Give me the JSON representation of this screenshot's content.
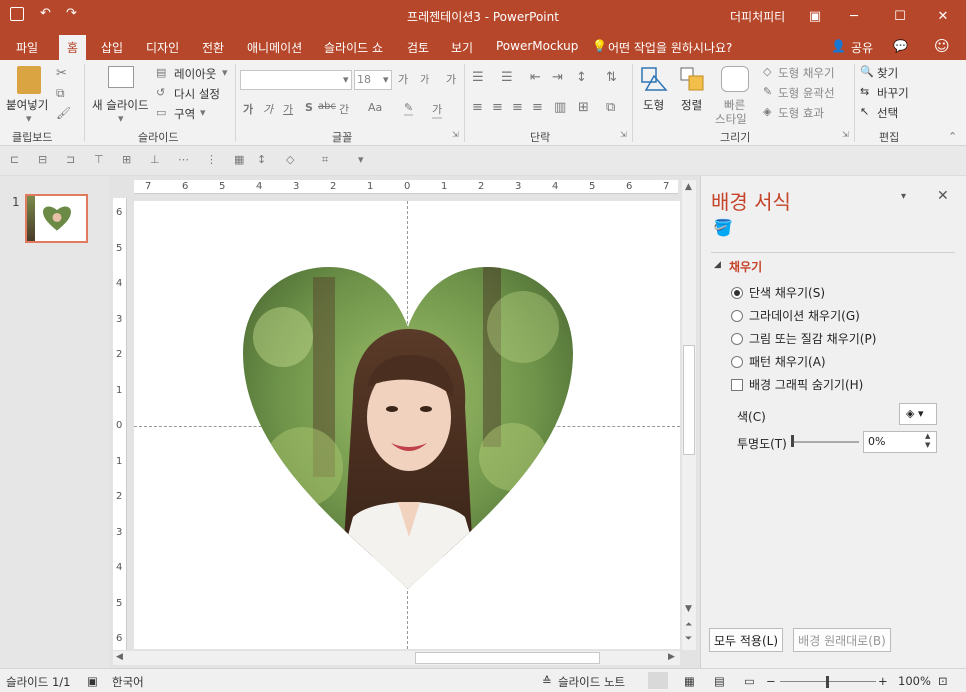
{
  "window": {
    "title": "프레젠테이션3 - PowerPoint",
    "user": "더피처피티",
    "ribbon_display_icon": "ribbon-display-icon",
    "minimize_icon": "minimize-icon",
    "maximize_icon": "maximize-icon",
    "close_icon": "close-icon"
  },
  "tabs": [
    "파일",
    "홈",
    "삽입",
    "디자인",
    "전환",
    "애니메이션",
    "슬라이드 쇼",
    "검토",
    "보기",
    "PowerMockup"
  ],
  "active_tab": "홈",
  "tell_me": "어떤 작업을 원하시나요?",
  "share": "공유",
  "ribbon": {
    "clipboard": {
      "paste": "붙여넣기",
      "label": "클립보드"
    },
    "slides": {
      "new_slide": "새 슬라이드",
      "layout": "레이아웃",
      "reset": "다시 설정",
      "section": "구역",
      "label": "슬라이드"
    },
    "font": {
      "size": "18",
      "label": "글꼴",
      "bold": "가",
      "italic": "가",
      "underline": "가",
      "shadow": "S",
      "strike": "abc",
      "spacing": "간",
      "case": "Aa",
      "grow": "가",
      "shrink": "가",
      "clear": "가",
      "color": "가"
    },
    "paragraph": {
      "label": "단락"
    },
    "drawing": {
      "shape": "도형",
      "arrange": "정렬",
      "quick_styles_1": "빠른",
      "quick_styles_2": "스타일",
      "shape_fill": "도형 채우기",
      "shape_outline": "도형 윤곽선",
      "shape_effects": "도형 효과",
      "label": "그리기"
    },
    "editing": {
      "find": "찾기",
      "replace": "바꾸기",
      "select": "선택",
      "label": "편집"
    }
  },
  "ruler": {
    "h_ticks": [
      "7",
      "6",
      "5",
      "4",
      "3",
      "2",
      "1",
      "0",
      "1",
      "2",
      "3",
      "4",
      "5",
      "6",
      "7"
    ],
    "v_ticks": [
      "6",
      "5",
      "4",
      "3",
      "2",
      "1",
      "0",
      "1",
      "2",
      "3",
      "4",
      "5",
      "6"
    ]
  },
  "thumbnails": [
    {
      "number": "1"
    }
  ],
  "format_pane": {
    "title": "배경 서식",
    "section": "채우기",
    "options": [
      {
        "label": "단색 채우기(S)",
        "checked": true
      },
      {
        "label": "그라데이션 채우기(G)",
        "checked": false
      },
      {
        "label": "그림 또는 질감 채우기(P)",
        "checked": false
      },
      {
        "label": "패턴 채우기(A)",
        "checked": false
      }
    ],
    "hide_graphics": "배경 그래픽 숨기기(H)",
    "color_label": "색(C)",
    "transparency_label": "투명도(T)",
    "transparency_value": "0%",
    "apply_all": "모두 적용(L)",
    "reset_background": "배경 원래대로(B)"
  },
  "statusbar": {
    "slide_info": "슬라이드 1/1",
    "language": "한국어",
    "notes": "슬라이드 노트",
    "zoom": "100%"
  },
  "colors": {
    "accent": "#b7472a",
    "pane_title": "#c5442a"
  }
}
